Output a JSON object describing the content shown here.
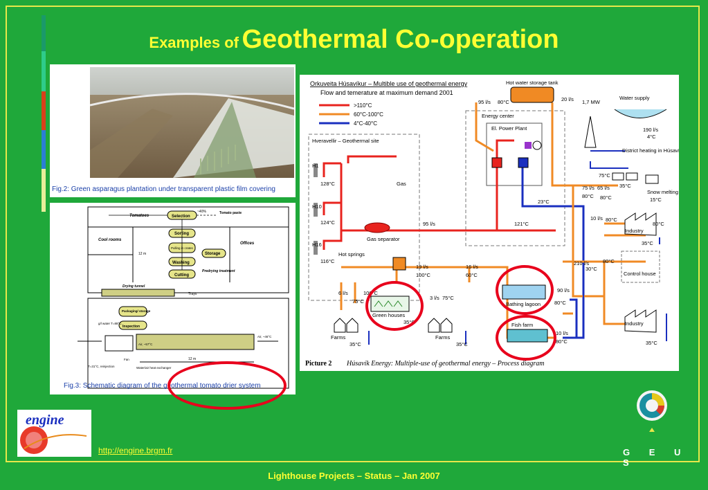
{
  "title": {
    "prefix": "Examples of",
    "main": "Geothermal Co-operation"
  },
  "fig2": {
    "caption": "Fig.2: Green asparagus plantation under transparent plastic film covering"
  },
  "fig3": {
    "caption": "Fig.3: Schematic diagram of the geothermal tomato drier system",
    "labels": {
      "tomatoes": "Tomatoes",
      "selection": "Selection",
      "pct": "~40%",
      "tomato_paste": "Tomato paste",
      "cool_rooms": "Cool rooms",
      "sorting": "Sorting",
      "offices": "Offices",
      "twelve_m": "12 m",
      "pulling": "Pulling in crates",
      "storage": "Storage",
      "washing": "Washing",
      "cutting": "Cutting",
      "predrying": "Predrying treatment",
      "drying_tunnel": "Drying tunnel",
      "trays": "Trays",
      "packaging": "Packaging/ storage",
      "inspection": "Inspection",
      "geo_water": "g/l water T=88°C",
      "reinjection": "T=31°C, reinjection",
      "fan": "Fan",
      "exchanger": "Water/air heat exchanger",
      "air_in": "Air, ~57°C",
      "air_out": "Air, ~46°C",
      "length": "12 m"
    }
  },
  "picture2": {
    "caption_bold": "Picture 2",
    "caption_italic": "Húsavík Energy: Multiple-use of geothermal energy – Process diagram",
    "header": "Orkuveita Húsavíkur – Multible use of geothermal energy",
    "subheader": "Flow and temerature at maximum demand 2001",
    "legend": [
      {
        "label": ">110°C",
        "color": "#e8231e"
      },
      {
        "label": "60°C-100°C",
        "color": "#f08a24"
      },
      {
        "label": "4°C-40°C",
        "color": "#1a2fbf"
      }
    ],
    "labels": {
      "hot_water_tank": "Hot water storage tank",
      "flow_95": "95 l/s",
      "temp_80": "80°C",
      "flow_20": "20 l/s",
      "power_17": "1,7 MW",
      "water_supply": "Water supply",
      "energy_center": "Energy center",
      "power_plant": "El. Power Plant",
      "flow_190": "190 l/s",
      "temp_4": "4°C",
      "hveravellir": "Hveravellir – Geothermal site",
      "district": "District heating in Húsavík town",
      "h1": "H1",
      "h10": "H10",
      "h16": "H16",
      "t128": "128°C",
      "t124": "124°C",
      "t116": "116°C",
      "gas": "Gas",
      "t75": "75°C",
      "t35a": "35°C",
      "snow": "Snow melting",
      "t15": "15°C",
      "f75": "75 l/s",
      "f65": "65 l/s",
      "t80a": "80°C",
      "t80b": "80°C",
      "t23": "23°C",
      "f95b": "95 l/s",
      "t121": "121°C",
      "gas_sep": "Gas separator",
      "f10": "10 l/s",
      "t80c": "80°C",
      "industry1": "Industry",
      "t80d": "80°C",
      "t35b": "35°C",
      "hot_springs": "Hot springs",
      "f19": "19 l/s",
      "t100": "100°C",
      "f16": "16 l/s",
      "t60": "60°C",
      "f210": "210 l/s",
      "t30": "30°C",
      "t80e": "80°C",
      "control_house": "Control house",
      "f90": "90 l/s",
      "bathing": "Bathing lagoon",
      "t80f": "80°C",
      "green_houses": "Green houses",
      "farms1": "Farms",
      "farms2": "Farms",
      "f3": "3 l/s",
      "t75b": "75°C",
      "fish_farm": "Fish farm",
      "f10b": "10 l/s",
      "t80g": "80°C",
      "industry2": "Industry",
      "t35c": "35°C",
      "t35d": "35°C",
      "t35e": "35°C",
      "f6": "6 l/s",
      "t75c": "75°C",
      "t100b": "100°C",
      "t35f": "35°C"
    }
  },
  "engine_logo": {
    "text": "engine"
  },
  "link": {
    "text": "http://engine.brgm.fr"
  },
  "geus": {
    "text": "G E U S"
  },
  "footer": {
    "text": "Lighthouse Projects – Status – Jan 2007"
  },
  "colors": {
    "background": "#1fa83a",
    "accent": "#ffff33",
    "highlight": "#e8001c"
  }
}
